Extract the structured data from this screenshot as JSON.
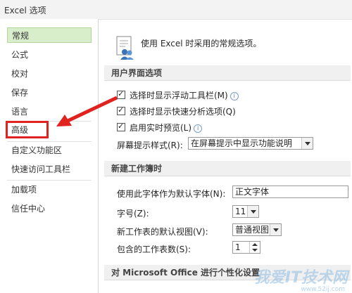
{
  "window": {
    "title": "Excel 选项"
  },
  "sidebar": {
    "items": [
      {
        "label": "常规",
        "selected": true
      },
      {
        "label": "公式"
      },
      {
        "label": "校对"
      },
      {
        "label": "保存"
      },
      {
        "label": "语言"
      },
      {
        "label": "高级",
        "highlighted": true
      },
      {
        "label": "自定义功能区"
      },
      {
        "label": "快速访问工具栏"
      },
      {
        "label": "加载项"
      },
      {
        "label": "信任中心"
      }
    ]
  },
  "main": {
    "intro": "使用 Excel 时采用的常规选项。",
    "section_ui": {
      "title": "用户界面选项",
      "options": [
        {
          "label": "选择时显示浮动工具栏(M)",
          "checked": true,
          "info": true
        },
        {
          "label": "选择时显示快速分析选项(Q)",
          "checked": true,
          "info": false
        },
        {
          "label": "启用实时预览(L)",
          "checked": true,
          "info": true
        }
      ],
      "screentip_label": "屏幕提示样式(R):",
      "screentip_value": "在屏幕提示中显示功能说明"
    },
    "section_new": {
      "title": "新建工作簿时",
      "font_label": "使用此字体作为默认字体(N):",
      "font_value": "正文字体",
      "size_label": "字号(Z):",
      "size_value": "11",
      "view_label": "新工作表的默认视图(V):",
      "view_value": "普通视图",
      "sheets_label": "包含的工作表数(S):",
      "sheets_value": "1"
    },
    "section_office": {
      "title": "对 Microsoft Office 进行个性化设置"
    }
  },
  "watermark": {
    "main": "我爱IT技术网",
    "url": "www.52ij.com"
  },
  "colors": {
    "selected_bg": "#d8eecb",
    "highlight": "#e0231f",
    "arrow": "#e0231f"
  }
}
